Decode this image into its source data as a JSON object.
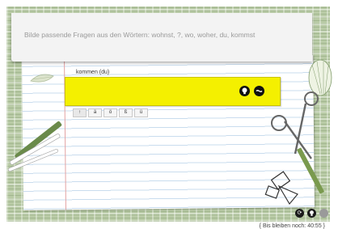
{
  "instruction": "Bilde passende Fragen aus den Wörtern: wohnst, ?, wo, woher, du, kommst",
  "exercise": {
    "word_label": "kommen (du)",
    "answer_value": "",
    "hint_icon": "lightbulb-icon",
    "check_icon": "dots-icon"
  },
  "keys": [
    "↑",
    "ä",
    "ö",
    "ß",
    "ü"
  ],
  "bottom_bar": {
    "buttons": [
      {
        "name": "reset-button",
        "icon": "refresh-icon",
        "glyph": "⟳"
      },
      {
        "name": "hint-bulb-button",
        "icon": "lightbulb-icon",
        "glyph": "💡"
      },
      {
        "name": "menu-button",
        "icon": "circle-icon",
        "glyph": ""
      }
    ]
  },
  "footer_text": "{ Bis bleiben noch: 40:55 }"
}
